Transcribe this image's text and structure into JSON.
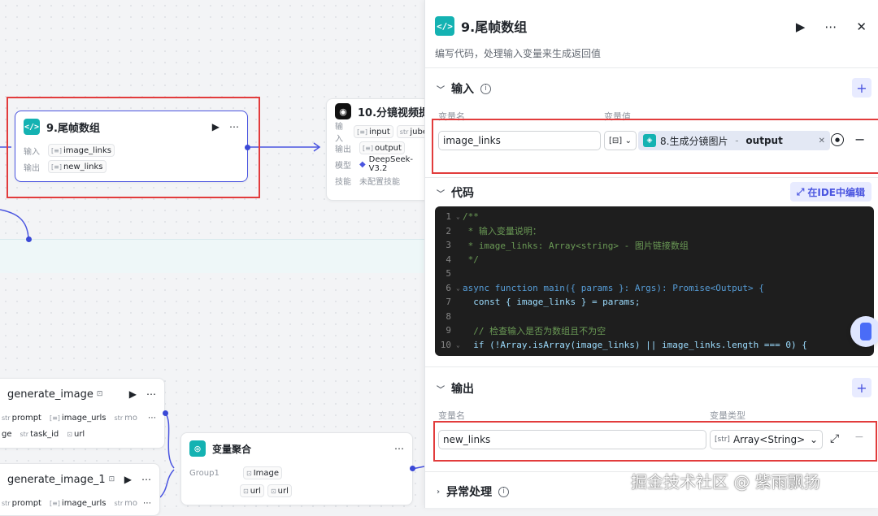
{
  "canvas": {
    "node_tail": {
      "title": "9.尾帧数组",
      "input_label": "输入",
      "input_var": "image_links",
      "output_label": "输出",
      "output_var": "new_links"
    },
    "node_video": {
      "title": "10.分镜视频提",
      "input_label": "输入",
      "input_var1": "input",
      "input_var2": "jube",
      "output_label": "输出",
      "output_var": "output",
      "model_label": "模型",
      "model_value": "DeepSeek-V3.2",
      "skill_label": "技能",
      "skill_value": "未配置技能"
    },
    "node_gen1": {
      "title": "generate_image",
      "var1": "prompt",
      "var2": "image_urls",
      "var3": "mo",
      "var4": "ge",
      "var5": "task_id",
      "var6": "url"
    },
    "node_gen2": {
      "title": "generate_image_1",
      "var1": "prompt",
      "var2": "image_urls",
      "var3": "mo"
    },
    "node_agg": {
      "title": "变量聚合",
      "group_label": "Group1",
      "var1": "Image",
      "var2": "url",
      "var3": "url"
    }
  },
  "panel": {
    "title": "9.尾帧数组",
    "description": "编写代码，处理输入变量来生成返回值",
    "input_section": {
      "title": "输入",
      "col_name": "变量名",
      "col_value": "变量值",
      "var_name": "image_links",
      "ref_source": "8.生成分镜图片",
      "ref_sep": " - ",
      "ref_field": "output"
    },
    "code_section": {
      "title": "代码",
      "ide_label": "在IDE中编辑"
    },
    "output_section": {
      "title": "输出",
      "col_name": "变量名",
      "col_type": "变量类型",
      "var_name": "new_links",
      "var_type": "Array<String>"
    },
    "error_section": {
      "title": "异常处理"
    }
  },
  "code_lines": [
    "/**",
    " * 输入变量说明：",
    " * image_links: Array<string> - 图片链接数组",
    " */",
    "",
    "async function main({ params }: Args): Promise<Output> {",
    "  const { image_links } = params;",
    "",
    "  // 检查输入是否为数组且不为空",
    "  if (!Array.isArray(image_links) || image_links.length === 0) {"
  ],
  "watermark": "掘金技术社区 @ 紫雨飘扬"
}
